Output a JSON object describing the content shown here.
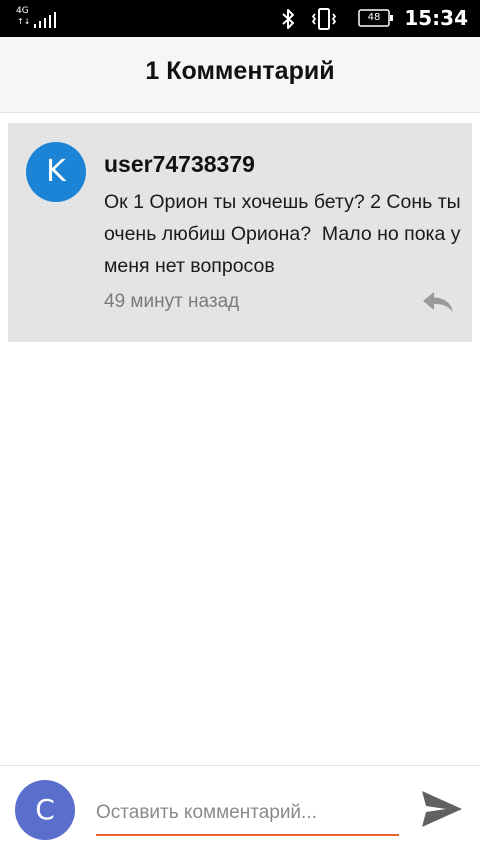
{
  "status_bar": {
    "network_type": "4G",
    "data_arrows": "↑↓",
    "battery_level": "48",
    "time": "15:34",
    "icons": {
      "signal": "signal-bars-icon",
      "bluetooth": "bluetooth-icon",
      "vibrate": "vibrate-icon",
      "battery": "battery-icon"
    }
  },
  "header": {
    "title": "1 Комментарий"
  },
  "comments": [
    {
      "avatar_letter": "K",
      "avatar_color": "#1b84d6",
      "author": "user74738379",
      "text": "Ок 1 Орион ты хочешь бету? 2 Сонь ты очень любиш Ориона?  Мало но пока у меня нет вопросов",
      "time": "49 минут назад",
      "reply_icon": "reply-icon"
    }
  ],
  "composer": {
    "avatar_letter": "C",
    "avatar_color": "#5a6fcc",
    "placeholder": "Оставить комментарий...",
    "value": "",
    "underline_color": "#e8622e",
    "send_icon": "send-icon"
  }
}
